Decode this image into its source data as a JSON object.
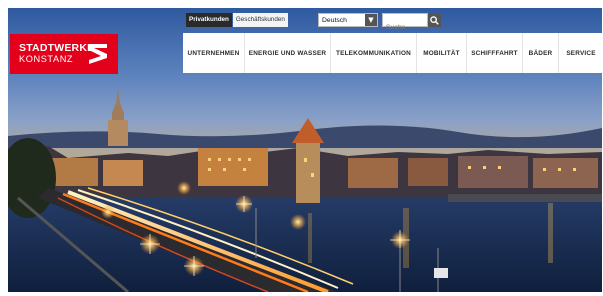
{
  "utility": {
    "customer_tabs": [
      "Privatkunden",
      "Geschäftskunden"
    ],
    "active_tab": "Privatkunden",
    "language": "Deutsch",
    "search_placeholder": "Suche"
  },
  "logo": {
    "line1": "STADTWERKE",
    "line2": "KONSTANZ"
  },
  "nav": {
    "items": [
      "UNTERNEHMEN",
      "ENERGIE UND WASSER",
      "TELEKOMMUNIKATION",
      "MOBILITÄT",
      "SCHIFFFAHRT",
      "BÄDER",
      "SERVICE"
    ]
  },
  "colors": {
    "brand_red": "#e2001a",
    "nav_bg": "#ffffff",
    "nav_text": "#2b2b2b",
    "sky_top": "#2a4d86",
    "water": "#1a2f55"
  },
  "icons": {
    "search": "magnifier-icon",
    "dropdown": "triangle-down-icon",
    "logo_mark": "stadtwerke-s-mark"
  },
  "hero": {
    "subject": "Konstanz harbour at dusk with light trails on bridge"
  }
}
